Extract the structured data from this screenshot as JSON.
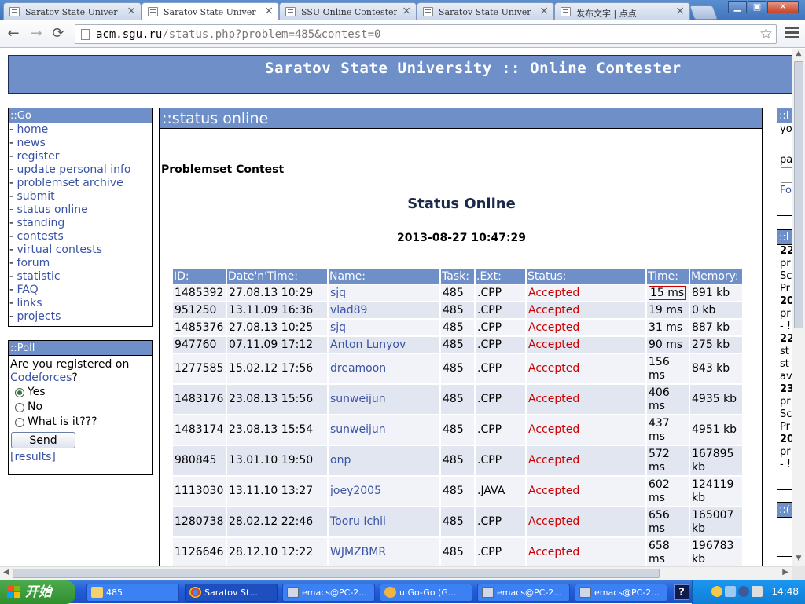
{
  "browser": {
    "tabs": [
      {
        "title": "Saratov State Univer",
        "active": false
      },
      {
        "title": "Saratov State Univer",
        "active": true
      },
      {
        "title": "SSU Online Contester",
        "active": false
      },
      {
        "title": "Saratov State Univer",
        "active": false
      },
      {
        "title": "发布文字 | 点点",
        "active": false
      }
    ],
    "close_glyph": "×",
    "url_host": "acm.sgu.ru",
    "url_path": "/status.php?problem=485&contest=0"
  },
  "site": {
    "title": "Saratov State University :: Online Contester"
  },
  "go_panel": {
    "title": "::Go",
    "items": [
      "home",
      "news",
      "register",
      "update personal info",
      "problemset archive",
      "submit",
      "status online",
      "standing",
      "contests",
      "virtual contests",
      "forum",
      "statistic",
      "FAQ",
      "links",
      "projects"
    ]
  },
  "poll_panel": {
    "title": "::Poll",
    "question_prefix": "Are you registered on",
    "question_link": "Codeforces",
    "question_suffix": "?",
    "options": [
      "Yes",
      "No",
      "What is it???"
    ],
    "selected_index": 0,
    "send_label": "Send",
    "results_label": "[results]"
  },
  "main": {
    "title": "::status online",
    "breadcrumb": "Problemset Contest",
    "heading": "Status Online",
    "timestamp": "2013-08-27 10:47:29",
    "columns": [
      "ID:",
      "Date'n'Time:",
      "Name:",
      "Task:",
      ".Ext:",
      "Status:",
      "Time:",
      "Memory:"
    ],
    "rows": [
      {
        "id": "1485392",
        "datetime": "27.08.13 10:29",
        "name": "sjq",
        "task": "485",
        "ext": ".CPP",
        "status": "Accepted",
        "time": "15 ms",
        "memory": "891 kb"
      },
      {
        "id": "951250",
        "datetime": "13.11.09 16:36",
        "name": "vlad89",
        "task": "485",
        "ext": ".CPP",
        "status": "Accepted",
        "time": "19 ms",
        "memory": "0 kb"
      },
      {
        "id": "1485376",
        "datetime": "27.08.13 10:25",
        "name": "sjq",
        "task": "485",
        "ext": ".CPP",
        "status": "Accepted",
        "time": "31 ms",
        "memory": "887 kb"
      },
      {
        "id": "947760",
        "datetime": "07.11.09 17:12",
        "name": "Anton Lunyov",
        "task": "485",
        "ext": ".CPP",
        "status": "Accepted",
        "time": "90 ms",
        "memory": "275 kb"
      },
      {
        "id": "1277585",
        "datetime": "15.02.12 17:56",
        "name": "dreamoon",
        "task": "485",
        "ext": ".CPP",
        "status": "Accepted",
        "time": "156 ms",
        "memory": "843 kb"
      },
      {
        "id": "1483176",
        "datetime": "23.08.13 15:56",
        "name": "sunweijun",
        "task": "485",
        "ext": ".CPP",
        "status": "Accepted",
        "time": "406 ms",
        "memory": "4935 kb"
      },
      {
        "id": "1483174",
        "datetime": "23.08.13 15:54",
        "name": "sunweijun",
        "task": "485",
        "ext": ".CPP",
        "status": "Accepted",
        "time": "437 ms",
        "memory": "4951 kb"
      },
      {
        "id": "980845",
        "datetime": "13.01.10 19:50",
        "name": "onp",
        "task": "485",
        "ext": ".CPP",
        "status": "Accepted",
        "time": "572 ms",
        "memory": "167895 kb"
      },
      {
        "id": "1113030",
        "datetime": "13.11.10 13:27",
        "name": "joey2005",
        "task": "485",
        "ext": ".JAVA",
        "status": "Accepted",
        "time": "602 ms",
        "memory": "124119 kb"
      },
      {
        "id": "1280738",
        "datetime": "28.02.12 22:46",
        "name": "Tooru Ichii",
        "task": "485",
        "ext": ".CPP",
        "status": "Accepted",
        "time": "656 ms",
        "memory": "165007 kb"
      },
      {
        "id": "1126646",
        "datetime": "28.12.10 12:22",
        "name": "WJMZBMR",
        "task": "485",
        "ext": ".CPP",
        "status": "Accepted",
        "time": "658 ms",
        "memory": "196783 kb"
      }
    ]
  },
  "right_panels": {
    "login_title": "::l",
    "login_lines": [
      "yo",
      "pa",
      "Fo"
    ],
    "news_title": "::I",
    "news_lines": [
      "22",
      "pr",
      "Sc",
      "Pr",
      "20",
      "pr",
      "- !",
      "22",
      "st",
      "st",
      "av",
      "23",
      "pr",
      "Sc",
      "Pr",
      "20",
      "pr",
      "- !"
    ],
    "third_title": "::("
  },
  "taskbar": {
    "start_label": "开始",
    "tasks": [
      "485",
      "Saratov St...",
      "emacs@PC-2...",
      "u Go-Go (G...",
      "emacs@PC-2...",
      "emacs@PC-2..."
    ],
    "help_label": "?",
    "clock": "14:48"
  },
  "colors": {
    "accent_blue": "#6f8fc8",
    "link_blue": "#3a53a4",
    "accepted_red": "#cc0000"
  }
}
